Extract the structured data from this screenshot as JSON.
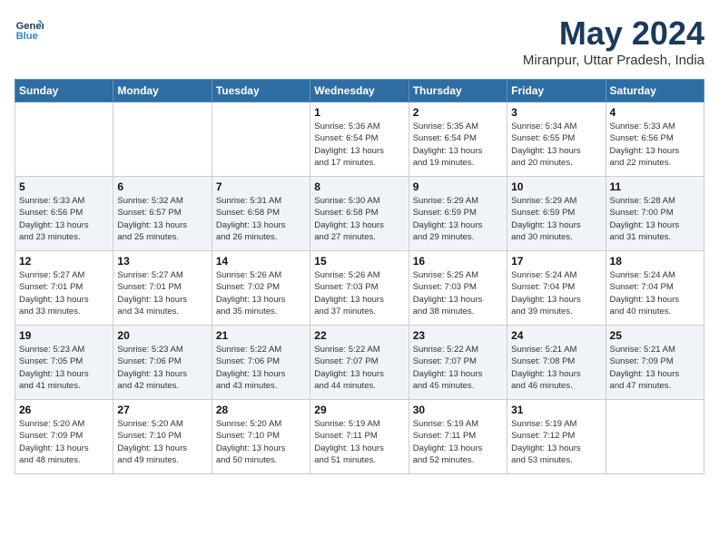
{
  "header": {
    "logo_line1": "General",
    "logo_line2": "Blue",
    "month": "May 2024",
    "location": "Miranpur, Uttar Pradesh, India"
  },
  "days_of_week": [
    "Sunday",
    "Monday",
    "Tuesday",
    "Wednesday",
    "Thursday",
    "Friday",
    "Saturday"
  ],
  "weeks": [
    [
      {
        "day": "",
        "info": ""
      },
      {
        "day": "",
        "info": ""
      },
      {
        "day": "",
        "info": ""
      },
      {
        "day": "1",
        "info": "Sunrise: 5:36 AM\nSunset: 6:54 PM\nDaylight: 13 hours\nand 17 minutes."
      },
      {
        "day": "2",
        "info": "Sunrise: 5:35 AM\nSunset: 6:54 PM\nDaylight: 13 hours\nand 19 minutes."
      },
      {
        "day": "3",
        "info": "Sunrise: 5:34 AM\nSunset: 6:55 PM\nDaylight: 13 hours\nand 20 minutes."
      },
      {
        "day": "4",
        "info": "Sunrise: 5:33 AM\nSunset: 6:56 PM\nDaylight: 13 hours\nand 22 minutes."
      }
    ],
    [
      {
        "day": "5",
        "info": "Sunrise: 5:33 AM\nSunset: 6:56 PM\nDaylight: 13 hours\nand 23 minutes."
      },
      {
        "day": "6",
        "info": "Sunrise: 5:32 AM\nSunset: 6:57 PM\nDaylight: 13 hours\nand 25 minutes."
      },
      {
        "day": "7",
        "info": "Sunrise: 5:31 AM\nSunset: 6:58 PM\nDaylight: 13 hours\nand 26 minutes."
      },
      {
        "day": "8",
        "info": "Sunrise: 5:30 AM\nSunset: 6:58 PM\nDaylight: 13 hours\nand 27 minutes."
      },
      {
        "day": "9",
        "info": "Sunrise: 5:29 AM\nSunset: 6:59 PM\nDaylight: 13 hours\nand 29 minutes."
      },
      {
        "day": "10",
        "info": "Sunrise: 5:29 AM\nSunset: 6:59 PM\nDaylight: 13 hours\nand 30 minutes."
      },
      {
        "day": "11",
        "info": "Sunrise: 5:28 AM\nSunset: 7:00 PM\nDaylight: 13 hours\nand 31 minutes."
      }
    ],
    [
      {
        "day": "12",
        "info": "Sunrise: 5:27 AM\nSunset: 7:01 PM\nDaylight: 13 hours\nand 33 minutes."
      },
      {
        "day": "13",
        "info": "Sunrise: 5:27 AM\nSunset: 7:01 PM\nDaylight: 13 hours\nand 34 minutes."
      },
      {
        "day": "14",
        "info": "Sunrise: 5:26 AM\nSunset: 7:02 PM\nDaylight: 13 hours\nand 35 minutes."
      },
      {
        "day": "15",
        "info": "Sunrise: 5:26 AM\nSunset: 7:03 PM\nDaylight: 13 hours\nand 37 minutes."
      },
      {
        "day": "16",
        "info": "Sunrise: 5:25 AM\nSunset: 7:03 PM\nDaylight: 13 hours\nand 38 minutes."
      },
      {
        "day": "17",
        "info": "Sunrise: 5:24 AM\nSunset: 7:04 PM\nDaylight: 13 hours\nand 39 minutes."
      },
      {
        "day": "18",
        "info": "Sunrise: 5:24 AM\nSunset: 7:04 PM\nDaylight: 13 hours\nand 40 minutes."
      }
    ],
    [
      {
        "day": "19",
        "info": "Sunrise: 5:23 AM\nSunset: 7:05 PM\nDaylight: 13 hours\nand 41 minutes."
      },
      {
        "day": "20",
        "info": "Sunrise: 5:23 AM\nSunset: 7:06 PM\nDaylight: 13 hours\nand 42 minutes."
      },
      {
        "day": "21",
        "info": "Sunrise: 5:22 AM\nSunset: 7:06 PM\nDaylight: 13 hours\nand 43 minutes."
      },
      {
        "day": "22",
        "info": "Sunrise: 5:22 AM\nSunset: 7:07 PM\nDaylight: 13 hours\nand 44 minutes."
      },
      {
        "day": "23",
        "info": "Sunrise: 5:22 AM\nSunset: 7:07 PM\nDaylight: 13 hours\nand 45 minutes."
      },
      {
        "day": "24",
        "info": "Sunrise: 5:21 AM\nSunset: 7:08 PM\nDaylight: 13 hours\nand 46 minutes."
      },
      {
        "day": "25",
        "info": "Sunrise: 5:21 AM\nSunset: 7:09 PM\nDaylight: 13 hours\nand 47 minutes."
      }
    ],
    [
      {
        "day": "26",
        "info": "Sunrise: 5:20 AM\nSunset: 7:09 PM\nDaylight: 13 hours\nand 48 minutes."
      },
      {
        "day": "27",
        "info": "Sunrise: 5:20 AM\nSunset: 7:10 PM\nDaylight: 13 hours\nand 49 minutes."
      },
      {
        "day": "28",
        "info": "Sunrise: 5:20 AM\nSunset: 7:10 PM\nDaylight: 13 hours\nand 50 minutes."
      },
      {
        "day": "29",
        "info": "Sunrise: 5:19 AM\nSunset: 7:11 PM\nDaylight: 13 hours\nand 51 minutes."
      },
      {
        "day": "30",
        "info": "Sunrise: 5:19 AM\nSunset: 7:11 PM\nDaylight: 13 hours\nand 52 minutes."
      },
      {
        "day": "31",
        "info": "Sunrise: 5:19 AM\nSunset: 7:12 PM\nDaylight: 13 hours\nand 53 minutes."
      },
      {
        "day": "",
        "info": ""
      }
    ]
  ]
}
